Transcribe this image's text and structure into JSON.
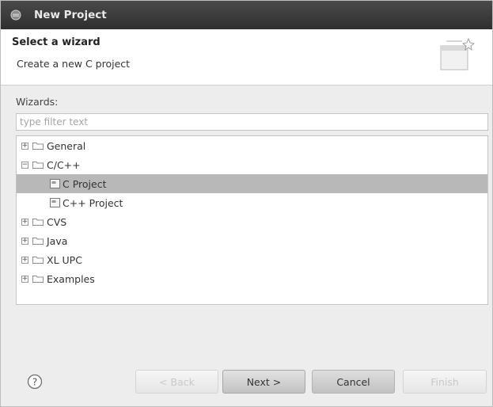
{
  "window": {
    "title": "New Project"
  },
  "banner": {
    "title": "Select a wizard",
    "description": "Create a new C project"
  },
  "wizards": {
    "label": "Wizards:",
    "filter_placeholder": "type filter text",
    "filter_value": ""
  },
  "tree": {
    "items": [
      {
        "label": "General",
        "expander": "+"
      },
      {
        "label": "C/C++",
        "expander": "−"
      },
      {
        "label": "C Project"
      },
      {
        "label": "C++ Project"
      },
      {
        "label": "CVS",
        "expander": "+"
      },
      {
        "label": "Java",
        "expander": "+"
      },
      {
        "label": "XL UPC",
        "expander": "+"
      },
      {
        "label": "Examples",
        "expander": "+"
      }
    ],
    "selected": "C Project"
  },
  "buttons": {
    "back": "< Back",
    "next": "Next >",
    "cancel": "Cancel",
    "finish": "Finish"
  },
  "icons": {
    "title": "eclipse-logo-icon",
    "banner": "new-wizard-icon",
    "help": "help-icon",
    "folder": "folder-icon",
    "file": "c-file-icon"
  }
}
